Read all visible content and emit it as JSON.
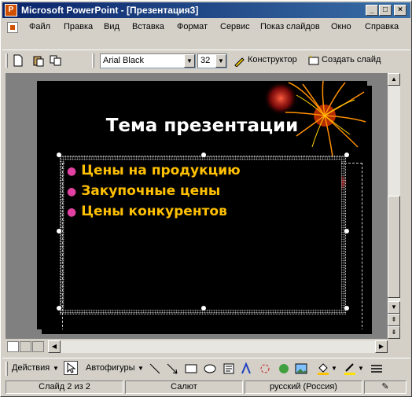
{
  "window": {
    "title": "Microsoft PowerPoint - [Презентация3]",
    "app_icon": "powerpoint-icon",
    "controls": [
      "_",
      "□",
      "×"
    ]
  },
  "menu": [
    "Файл",
    "Правка",
    "Вид",
    "Вставка",
    "Формат",
    "Сервис",
    "Показ слайдов",
    "Окно",
    "Справка"
  ],
  "toolbar": {
    "font_name": "Arial Black",
    "font_size": "32",
    "designer_label": "Конструктор",
    "new_slide_label": "Создать слайд",
    "icons": [
      "new-document-icon",
      "paste-icon",
      "copy-icon"
    ]
  },
  "slide": {
    "title": "Тема презентации",
    "bullets": [
      "Цены на продукцию",
      "Закупочные цены",
      "Цены конкурентов"
    ],
    "bullet_color": "#ffc000",
    "bullet_dot_color": "#e040a0",
    "background": "#000000"
  },
  "drawing_toolbar": {
    "actions_label": "Действия",
    "autoshapes_label": "Автофигуры"
  },
  "status": {
    "slide_info": "Слайд 2 из 2",
    "design": "Салют",
    "language": "русский (Россия)"
  }
}
